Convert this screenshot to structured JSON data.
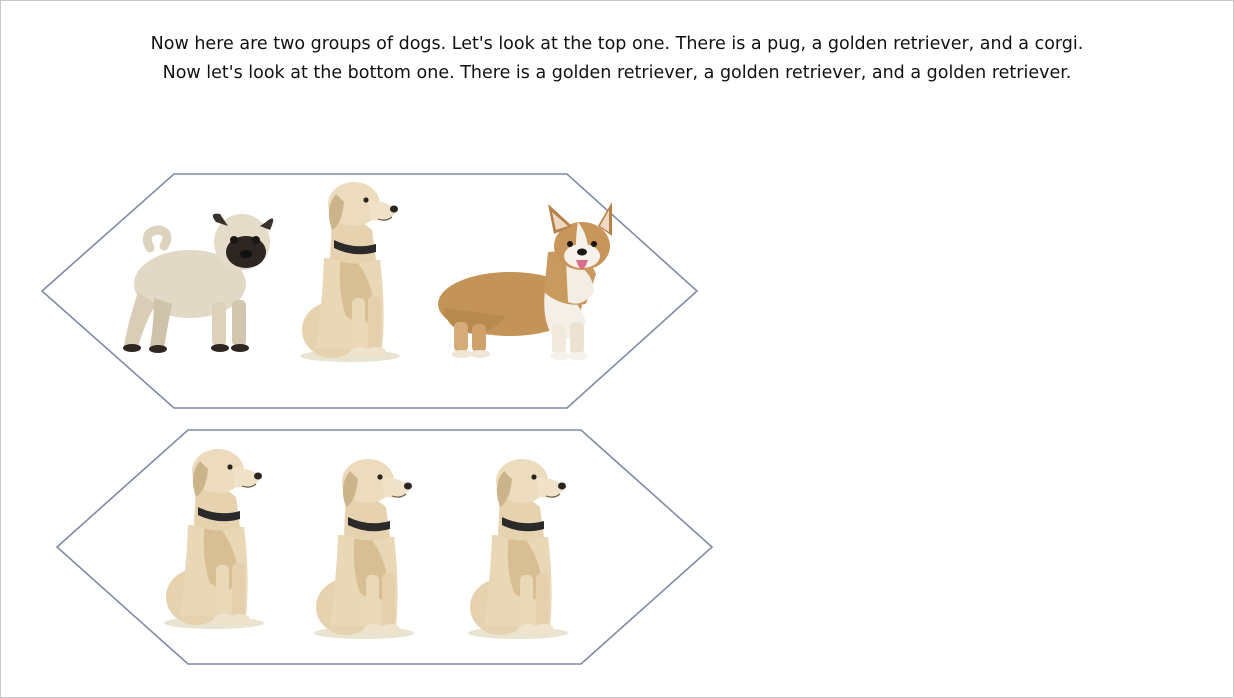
{
  "caption": {
    "line1": "Now here are two groups of dogs. Let's look at the top one. There is a pug, a golden retriever, and a corgi.",
    "line2": "Now let's look at the bottom one. There is a golden retriever, a golden retriever, and a golden retriever."
  },
  "colors": {
    "outline": "#7e8ba6",
    "pug_body": "#e2d8c6",
    "pug_mask": "#2d2622",
    "golden": "#e6d2ae",
    "golden_shadow": "#cbb48a",
    "collar": "#2a2a2a",
    "corgi_tan": "#c49358",
    "corgi_white": "#f4efe7",
    "tongue": "#d96f8c"
  },
  "groups": [
    {
      "dogs": [
        "pug",
        "golden retriever",
        "corgi"
      ]
    },
    {
      "dogs": [
        "golden retriever",
        "golden retriever",
        "golden retriever"
      ]
    }
  ]
}
